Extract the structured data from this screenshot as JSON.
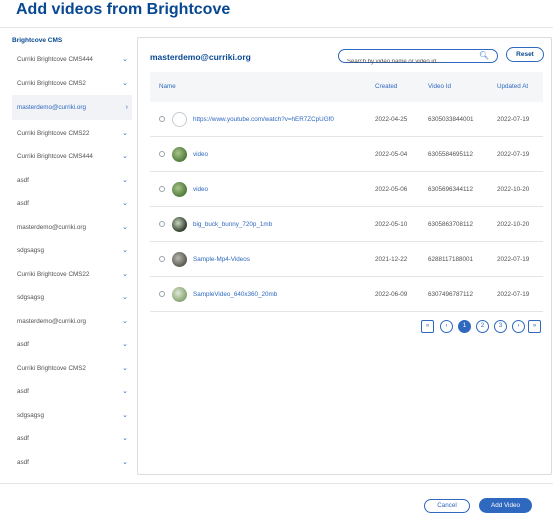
{
  "modal": {
    "title": "Add videos from Brightcove"
  },
  "sidebar": {
    "heading": "Brightcove CMS",
    "items": [
      {
        "label": "Curriki Brightcove CMS444",
        "active": false
      },
      {
        "label": "Curriki Brightcove CMS2",
        "active": false
      },
      {
        "label": "masterdemo@curriki.org",
        "active": true
      },
      {
        "label": "Curriki Brightcove CMS22",
        "active": false
      },
      {
        "label": "Curriki Brightcove CMS444",
        "active": false
      },
      {
        "label": "asdf",
        "active": false
      },
      {
        "label": "asdf",
        "active": false
      },
      {
        "label": "masterdemo@curriki.org",
        "active": false
      },
      {
        "label": "sdgsagsg",
        "active": false
      },
      {
        "label": "Curriki Brightcove CMS22",
        "active": false
      },
      {
        "label": "sdgsagsg",
        "active": false
      },
      {
        "label": "masterdemo@curriki.org",
        "active": false
      },
      {
        "label": "asdf",
        "active": false
      },
      {
        "label": "Curriki Brightcove CMS2",
        "active": false
      },
      {
        "label": "asdf",
        "active": false
      },
      {
        "label": "sdgsagsg",
        "active": false
      },
      {
        "label": "asdf",
        "active": false
      },
      {
        "label": "asdf",
        "active": false
      }
    ]
  },
  "panel": {
    "title": "masterdemo@curriki.org",
    "search_placeholder": "Search by video name or video id...",
    "reset_label": "Reset"
  },
  "table": {
    "columns": [
      "Name",
      "Created",
      "Video Id",
      "Updated At"
    ],
    "rows": [
      {
        "name": "https://www.youtube.com/watch?v=hER7ZCpUGf0",
        "created": "2022-04-25",
        "video_id": "6305033844001",
        "updated": "2022-07-19",
        "thumb": "empty"
      },
      {
        "name": "video",
        "created": "2022-05-04",
        "video_id": "6305584695112",
        "updated": "2022-07-19",
        "thumb": "green"
      },
      {
        "name": "video",
        "created": "2022-05-06",
        "video_id": "6305696344112",
        "updated": "2022-10-20",
        "thumb": "green"
      },
      {
        "name": "big_buck_bunny_720p_1mb",
        "created": "2022-05-10",
        "video_id": "6305863708112",
        "updated": "2022-10-20",
        "thumb": "dark"
      },
      {
        "name": "Sample-Mp4-Videos",
        "created": "2021-12-22",
        "video_id": "6288117188001",
        "updated": "2022-07-19",
        "thumb": "gray"
      },
      {
        "name": "SampleVideo_640x360_20mb",
        "created": "2022-06-09",
        "video_id": "6307496787112",
        "updated": "2022-07-19",
        "thumb": "light"
      }
    ]
  },
  "pagination": {
    "first": "«",
    "prev": "‹",
    "pages": [
      "1",
      "2",
      "3"
    ],
    "current": "1",
    "next": "›",
    "last": "»"
  },
  "footer": {
    "cancel_label": "Cancel",
    "add_label": "Add Video"
  },
  "colors": {
    "primary": "#084892",
    "accent": "#2e68bf",
    "text": "#515151"
  }
}
